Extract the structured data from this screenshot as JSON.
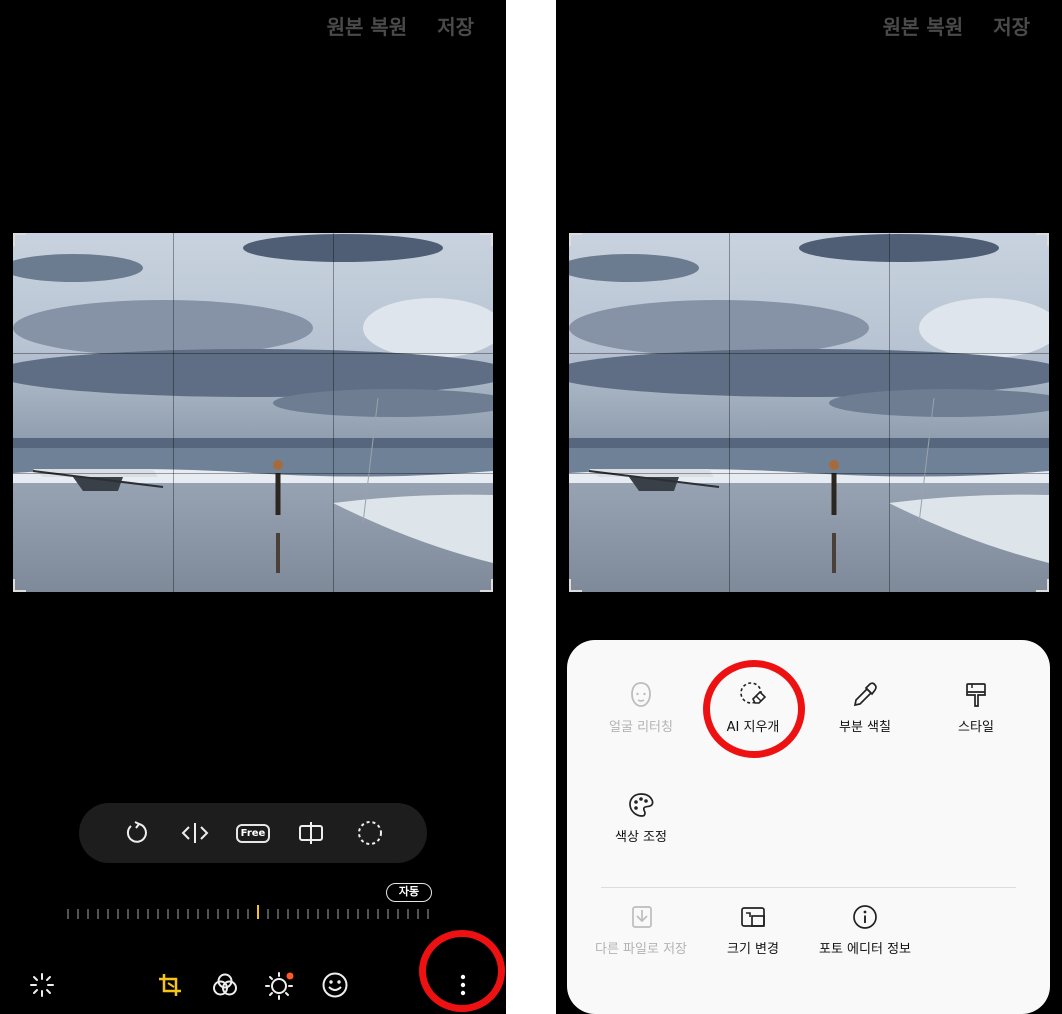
{
  "left_screen": {
    "top_actions": {
      "revert": "원본 복원",
      "save": "저장"
    },
    "transform_tools": [
      {
        "name": "rotate-icon"
      },
      {
        "name": "flip-icon"
      },
      {
        "name": "free-crop-icon",
        "label": "Free"
      },
      {
        "name": "perspective-icon"
      },
      {
        "name": "lasso-crop-icon"
      }
    ],
    "auto_label": "자동",
    "bottom_nav": [
      {
        "name": "auto-enhance-icon",
        "active": false
      },
      {
        "name": "transform-icon",
        "active": true
      },
      {
        "name": "filter-icon",
        "active": false
      },
      {
        "name": "tone-icon",
        "active": false,
        "badge": true
      },
      {
        "name": "decoration-icon",
        "active": false
      },
      {
        "name": "more-options-icon",
        "active": false
      }
    ]
  },
  "right_screen": {
    "top_actions": {
      "revert": "원본 복원",
      "save": "저장"
    },
    "menu": {
      "row1": [
        {
          "label": "얼굴 리터칭",
          "icon": "face-icon",
          "disabled": true
        },
        {
          "label": "AI 지우개",
          "icon": "ai-eraser-icon",
          "disabled": false
        },
        {
          "label": "부분 색칠",
          "icon": "eyedropper-icon",
          "disabled": false
        },
        {
          "label": "스타일",
          "icon": "brush-icon",
          "disabled": false
        }
      ],
      "row2": [
        {
          "label": "색상 조정",
          "icon": "palette-icon",
          "disabled": false
        }
      ],
      "row3": [
        {
          "label": "다른 파일로 저장",
          "icon": "save-as-icon",
          "disabled": true
        },
        {
          "label": "크기 변경",
          "icon": "resize-icon",
          "disabled": false
        },
        {
          "label": "포토 에디터 정보",
          "icon": "info-icon",
          "disabled": false
        }
      ]
    }
  },
  "colors": {
    "accent": "#f5c518",
    "highlight": "#ee1111",
    "badge": "#ff5a1f"
  }
}
